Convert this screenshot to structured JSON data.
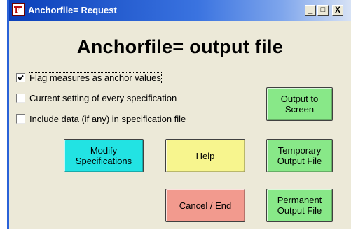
{
  "window": {
    "title": "Anchorfile= Request",
    "icon_letter": "F",
    "controls": {
      "minimize": "_",
      "maximize": "□",
      "close": "X"
    }
  },
  "heading": "Anchorfile= output file",
  "options": [
    {
      "label": "Flag measures as anchor values",
      "checked": true
    },
    {
      "label": "Current setting of every specification",
      "checked": false
    },
    {
      "label": "Include data (if any) in specification file",
      "checked": false
    }
  ],
  "buttons": {
    "output_to_screen": {
      "line1": "Output to",
      "line2": "Screen",
      "color": "#88e888"
    },
    "modify_specifications": {
      "line1": "Modify",
      "line2": "Specifications",
      "color": "#22e3e3"
    },
    "help": {
      "label": "Help",
      "color": "#f7f58e"
    },
    "temporary_output_file": {
      "line1": "Temporary",
      "line2": "Output File",
      "color": "#88e888"
    },
    "cancel_end": {
      "label": "Cancel / End",
      "color": "#f29a8e"
    },
    "permanent_output_file": {
      "line1": "Permanent",
      "line2": "Output File",
      "color": "#88e888"
    }
  }
}
